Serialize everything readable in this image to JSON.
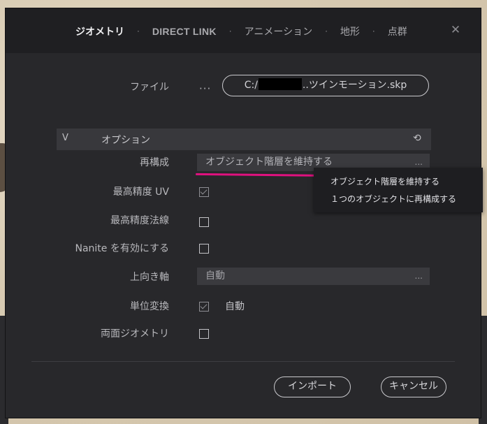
{
  "tabs": [
    {
      "label": "ジオメトリ",
      "active": true
    },
    {
      "label": "DIRECT LINK",
      "active": false
    },
    {
      "label": "アニメーション",
      "active": false
    },
    {
      "label": "地形",
      "active": false
    },
    {
      "label": "点群",
      "active": false
    }
  ],
  "tab_separator": "·",
  "close_glyph": "✕",
  "file": {
    "label": "ファイル",
    "browse_glyph": "···",
    "path_prefix": "C:/",
    "path_suffix": "..ツインモーション.skp"
  },
  "options": {
    "chevron": "V",
    "title": "オプション",
    "reset_glyph": "⟲"
  },
  "rows": {
    "restructure": {
      "label": "再構成",
      "value": "オブジェクト階層を維持する",
      "more": "..."
    },
    "uv": {
      "label": "最高精度 UV",
      "checked": true
    },
    "normals": {
      "label": "最高精度法線",
      "checked": false
    },
    "nanite": {
      "label": "Nanite を有効にする",
      "checked": false
    },
    "up_axis": {
      "label": "上向き軸",
      "value": "自動",
      "more": "..."
    },
    "units": {
      "label": "単位変換",
      "checked": true,
      "value": "自動"
    },
    "double_sided": {
      "label": "両面ジオメトリ",
      "checked": false
    }
  },
  "dropdown": {
    "items": [
      "オブジェクト階層を維持する",
      "１つのオブジェクトに再構成する"
    ]
  },
  "buttons": {
    "import": "インポート",
    "cancel": "キャンセル"
  },
  "colors": {
    "accent_underline": "#e0117f",
    "dialog_bg": "#28282b",
    "titlebar_bg": "#1f1f22"
  }
}
